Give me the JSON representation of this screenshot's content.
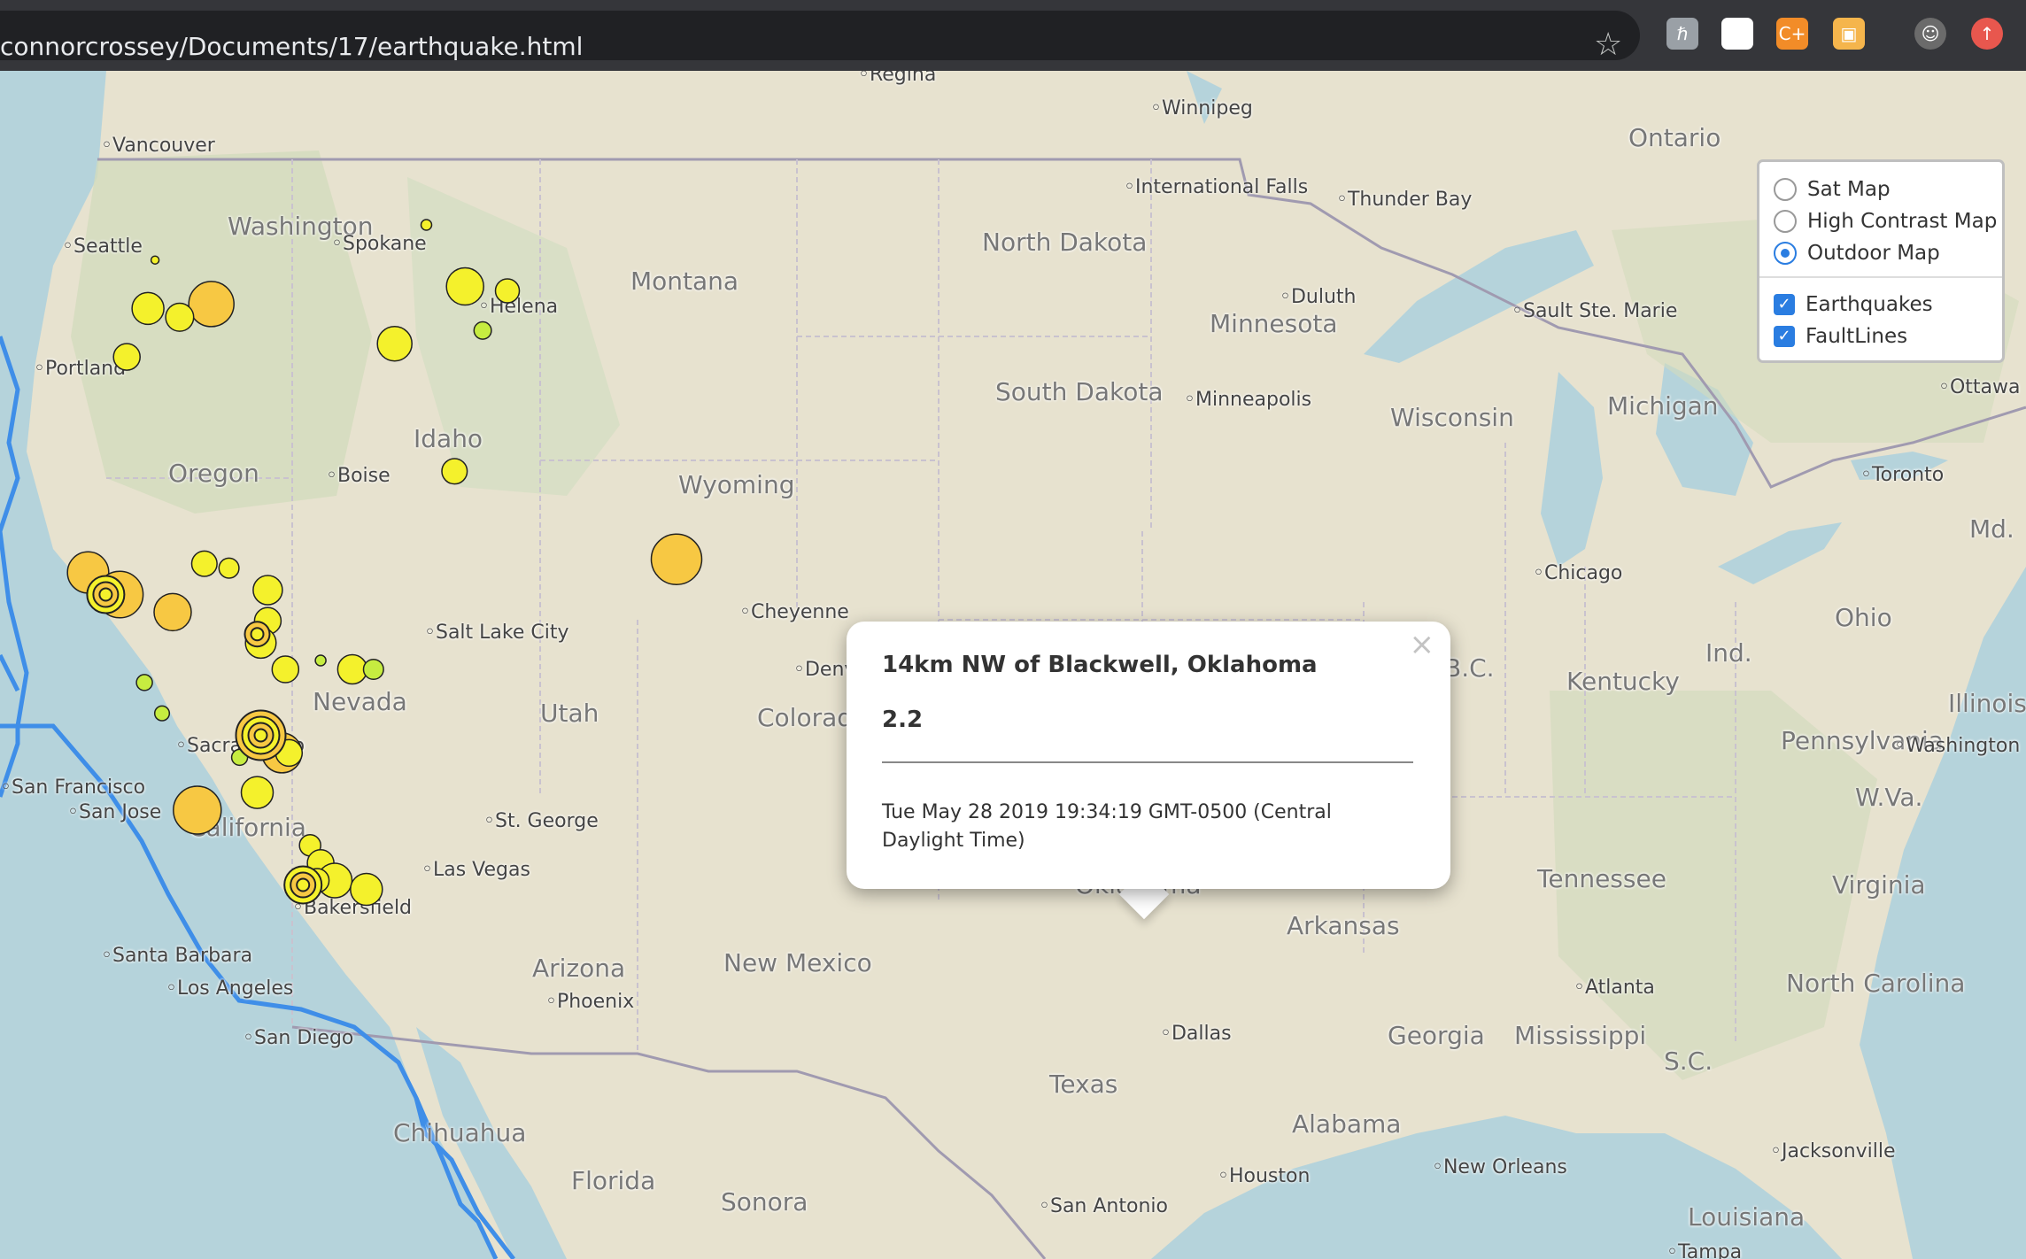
{
  "browser": {
    "url": "connorcrossey/Documents/17/earthquake.html",
    "bookmark_icon": "star-icon",
    "extensions": [
      {
        "name": "extension-1-icon",
        "glyph": "ℏ",
        "color": "#9aa0a6"
      },
      {
        "name": "extension-2-icon",
        "glyph": "{·}",
        "color": "#ffffff"
      },
      {
        "name": "extension-3-icon",
        "glyph": "C+",
        "color": "#f28c28"
      },
      {
        "name": "extension-4-icon",
        "glyph": "▣",
        "color": "#f5b54c"
      },
      {
        "name": "profile-avatar-icon",
        "glyph": "☺",
        "color": "#6b6b6b"
      },
      {
        "name": "update-icon",
        "glyph": "↑",
        "color": "#e8574e"
      }
    ]
  },
  "layer_control": {
    "base_layers": [
      {
        "label": "Sat Map",
        "selected": false
      },
      {
        "label": "High Contrast Map",
        "selected": false
      },
      {
        "label": "Outdoor Map",
        "selected": true
      }
    ],
    "overlays": [
      {
        "label": "Earthquakes",
        "checked": true
      },
      {
        "label": "FaultLines",
        "checked": true
      }
    ]
  },
  "popup": {
    "title": "14km NW of Blackwell, Oklahoma",
    "magnitude": "2.2",
    "time": "Tue May 28 2019 19:34:19 GMT-0500 (Central Daylight Time)",
    "close_glyph": "×"
  },
  "map_labels": {
    "regions": [
      "Washington",
      "Montana",
      "North Dakota",
      "Minnesota",
      "South Dakota",
      "Wisconsin",
      "Michigan",
      "Ontario",
      "Oregon",
      "Idaho",
      "Wyoming",
      "Nevada",
      "Utah",
      "Colorado",
      "California",
      "Arizona",
      "New Mexico",
      "Oklahoma",
      "Texas",
      "Arkansas",
      "Tennessee",
      "Kentucky",
      "Ind.",
      "Ohio",
      "Pennsylvania",
      "W.Va.",
      "Virginia",
      "North Carolina",
      "S.C.",
      "Georgia",
      "Mississippi",
      "Alabama",
      "Louisiana",
      "Florida",
      "Sonora",
      "Chihuahua",
      "B.C.",
      "Illinois",
      "Md.",
      "New"
    ],
    "cities": [
      "Regina",
      "Winnipeg",
      "Vancouver",
      "Seattle",
      "Spokane",
      "International Falls",
      "Thunder Bay",
      "Helena",
      "Duluth",
      "Sault Ste. Marie",
      "Portland",
      "Ottawa",
      "Minneapolis",
      "Boise",
      "Toronto",
      "Chicago",
      "Cheyenne",
      "Salt Lake City",
      "Denver",
      "Sacramento",
      "San Francisco",
      "San Jose",
      "St. George",
      "Las Vegas",
      "Bakersfield",
      "Santa Barbara",
      "Los Angeles",
      "Phoenix",
      "San Diego",
      "Dallas",
      "Atlanta",
      "Houston",
      "New Orleans",
      "Jacksonville",
      "San Antonio",
      "Washington",
      "Tampa"
    ]
  },
  "quakes": [
    {
      "lon": -119.6,
      "lat": 45.9,
      "mag": 3.4,
      "color": "#f7c843"
    },
    {
      "lon": -121.4,
      "lat": 45.8,
      "mag": 2.4,
      "color": "#f4f12c"
    },
    {
      "lon": -120.5,
      "lat": 45.6,
      "mag": 2.1,
      "color": "#f4f12c"
    },
    {
      "lon": -122.0,
      "lat": 44.7,
      "mag": 2.0,
      "color": "#f4f12c"
    },
    {
      "lon": -112.4,
      "lat": 46.3,
      "mag": 2.8,
      "color": "#f4f12c"
    },
    {
      "lon": -111.2,
      "lat": 46.2,
      "mag": 1.8,
      "color": "#f4f12c"
    },
    {
      "lon": -114.4,
      "lat": 45.0,
      "mag": 2.6,
      "color": "#f4f12c"
    },
    {
      "lon": -111.9,
      "lat": 45.3,
      "mag": 1.3,
      "color": "#c6ec40"
    },
    {
      "lon": -113.5,
      "lat": 47.7,
      "mag": 0.8,
      "color": "#f4f12c"
    },
    {
      "lon": -121.2,
      "lat": 46.9,
      "mag": 0.6,
      "color": "#f4f12c"
    },
    {
      "lon": -112.7,
      "lat": 42.1,
      "mag": 1.9,
      "color": "#f4f12c"
    },
    {
      "lon": -106.4,
      "lat": 40.1,
      "mag": 3.8,
      "color": "#f7c843"
    },
    {
      "lon": -123.1,
      "lat": 39.8,
      "mag": 3.1,
      "color": "#f7c843"
    },
    {
      "lon": -122.2,
      "lat": 39.3,
      "mag": 3.5,
      "color": "#f7c843"
    },
    {
      "lon": -120.7,
      "lat": 38.9,
      "mag": 2.8,
      "color": "#f7c843"
    },
    {
      "lon": -119.8,
      "lat": 40.0,
      "mag": 1.9,
      "color": "#f4f12c"
    },
    {
      "lon": -119.1,
      "lat": 39.9,
      "mag": 1.5,
      "color": "#f4f12c"
    },
    {
      "lon": -118.0,
      "lat": 39.4,
      "mag": 2.2,
      "color": "#f4f12c"
    },
    {
      "lon": -118.0,
      "lat": 38.7,
      "mag": 2.0,
      "color": "#f4f12c"
    },
    {
      "lon": -118.2,
      "lat": 38.2,
      "mag": 2.3,
      "color": "#f4f12c"
    },
    {
      "lon": -117.5,
      "lat": 37.6,
      "mag": 2.0,
      "color": "#f4f12c"
    },
    {
      "lon": -115.6,
      "lat": 37.6,
      "mag": 2.2,
      "color": "#f4f12c"
    },
    {
      "lon": -115.0,
      "lat": 37.6,
      "mag": 1.5,
      "color": "#c6ec40"
    },
    {
      "lon": -116.5,
      "lat": 37.8,
      "mag": 0.8,
      "color": "#c6ec40"
    },
    {
      "lon": -117.6,
      "lat": 35.7,
      "mag": 3.0,
      "color": "#f7c843"
    },
    {
      "lon": -117.4,
      "lat": 35.7,
      "mag": 2.0,
      "color": "#f4f12c"
    },
    {
      "lon": -118.3,
      "lat": 34.8,
      "mag": 2.4,
      "color": "#f4f12c"
    },
    {
      "lon": -120.0,
      "lat": 34.4,
      "mag": 3.6,
      "color": "#f7c843"
    },
    {
      "lon": -116.8,
      "lat": 33.6,
      "mag": 1.6,
      "color": "#f4f12c"
    },
    {
      "lon": -116.5,
      "lat": 33.2,
      "mag": 2.0,
      "color": "#f4f12c"
    },
    {
      "lon": -116.1,
      "lat": 32.8,
      "mag": 2.6,
      "color": "#f4f12c"
    },
    {
      "lon": -115.2,
      "lat": 32.6,
      "mag": 2.4,
      "color": "#f4f12c"
    },
    {
      "lon": -116.6,
      "lat": 32.8,
      "mag": 1.8,
      "color": "#f4f12c"
    },
    {
      "lon": -121.5,
      "lat": 37.3,
      "mag": 1.2,
      "color": "#c6ec40"
    },
    {
      "lon": -121.0,
      "lat": 36.6,
      "mag": 1.1,
      "color": "#c6ec40"
    },
    {
      "lon": -118.8,
      "lat": 35.6,
      "mag": 1.2,
      "color": "#c6ec40"
    },
    {
      "lon": -97.5,
      "lat": 37.0,
      "mag": 2.2,
      "color": "#f7c843"
    }
  ],
  "clusters": [
    {
      "lon": -122.6,
      "lat": 39.3,
      "rings": 3
    },
    {
      "lon": -118.2,
      "lat": 36.1,
      "rings": 4
    },
    {
      "lon": -117.0,
      "lat": 32.7,
      "rings": 3
    },
    {
      "lon": -118.3,
      "lat": 38.4,
      "rings": 2
    }
  ]
}
